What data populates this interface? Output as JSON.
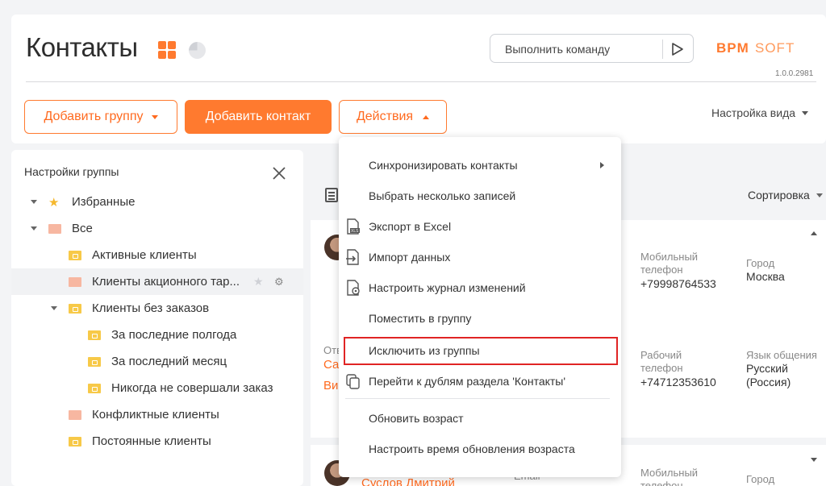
{
  "header": {
    "title": "Контакты",
    "command_placeholder": "Выполнить команду",
    "logo": "BPMSOFT",
    "version": "1.0.0.2981",
    "view_settings": "Настройка вида"
  },
  "toolbar": {
    "add_group": "Добавить группу",
    "add_contact": "Добавить контакт",
    "actions": "Действия"
  },
  "sidebar": {
    "title": "Настройки группы",
    "items": [
      {
        "label": "Избранные",
        "icon": "star-icon",
        "expanded": true
      },
      {
        "label": "Все",
        "icon": "folder-icon",
        "expanded": true
      },
      {
        "label": "Активные клиенты",
        "icon": "dynamic-folder-icon"
      },
      {
        "label": "Клиенты акционного тар...",
        "icon": "folder-icon",
        "selected": true
      },
      {
        "label": "Клиенты без заказов",
        "icon": "dynamic-folder-icon",
        "expanded": true
      },
      {
        "label": "За последние полгода",
        "icon": "dynamic-folder-icon"
      },
      {
        "label": "За последний месяц",
        "icon": "dynamic-folder-icon"
      },
      {
        "label": "Никогда не совершали заказ",
        "icon": "dynamic-folder-icon"
      },
      {
        "label": "Конфликтные клиенты",
        "icon": "folder-icon"
      },
      {
        "label": "Постоянные клиенты",
        "icon": "dynamic-folder-icon"
      }
    ]
  },
  "main": {
    "sort_label": "Сортировка",
    "card1": {
      "mobile_label": "Мобильный телефон",
      "mobile_value": "+79998764533",
      "city_label": "Город",
      "city_value": "Москва"
    },
    "card1b": {
      "partial_label": "Отв",
      "partial_link1": "Са",
      "partial_link2": "Ви",
      "work_label": "Рабочий телефон",
      "work_value": "+74712353610",
      "lang_label": "Язык общения",
      "lang_value": "Русский (Россия)"
    },
    "card2": {
      "name": "Суслов Дмитрий",
      "email_label": "Email",
      "mobile_label": "Мобильный телефон",
      "city_label": "Город"
    }
  },
  "actions_menu": {
    "items": [
      {
        "label": "Синхронизировать контакты",
        "submenu": true
      },
      {
        "label": "Выбрать несколько записей"
      },
      {
        "label": "Экспорт в Excel",
        "icon": "excel-export-icon"
      },
      {
        "label": "Импорт данных",
        "icon": "import-icon"
      },
      {
        "label": "Настроить журнал изменений",
        "icon": "changelog-settings-icon"
      },
      {
        "label": "Поместить в группу"
      },
      {
        "label": "Исключить из группы",
        "highlighted": true
      },
      {
        "label": "Перейти к дублям раздела 'Контакты'",
        "icon": "duplicates-icon"
      },
      {
        "label": "Обновить возраст"
      },
      {
        "label": "Настроить время обновления возраста"
      }
    ]
  },
  "colors": {
    "accent": "#ff7a2f",
    "highlight_border": "#e02424"
  }
}
